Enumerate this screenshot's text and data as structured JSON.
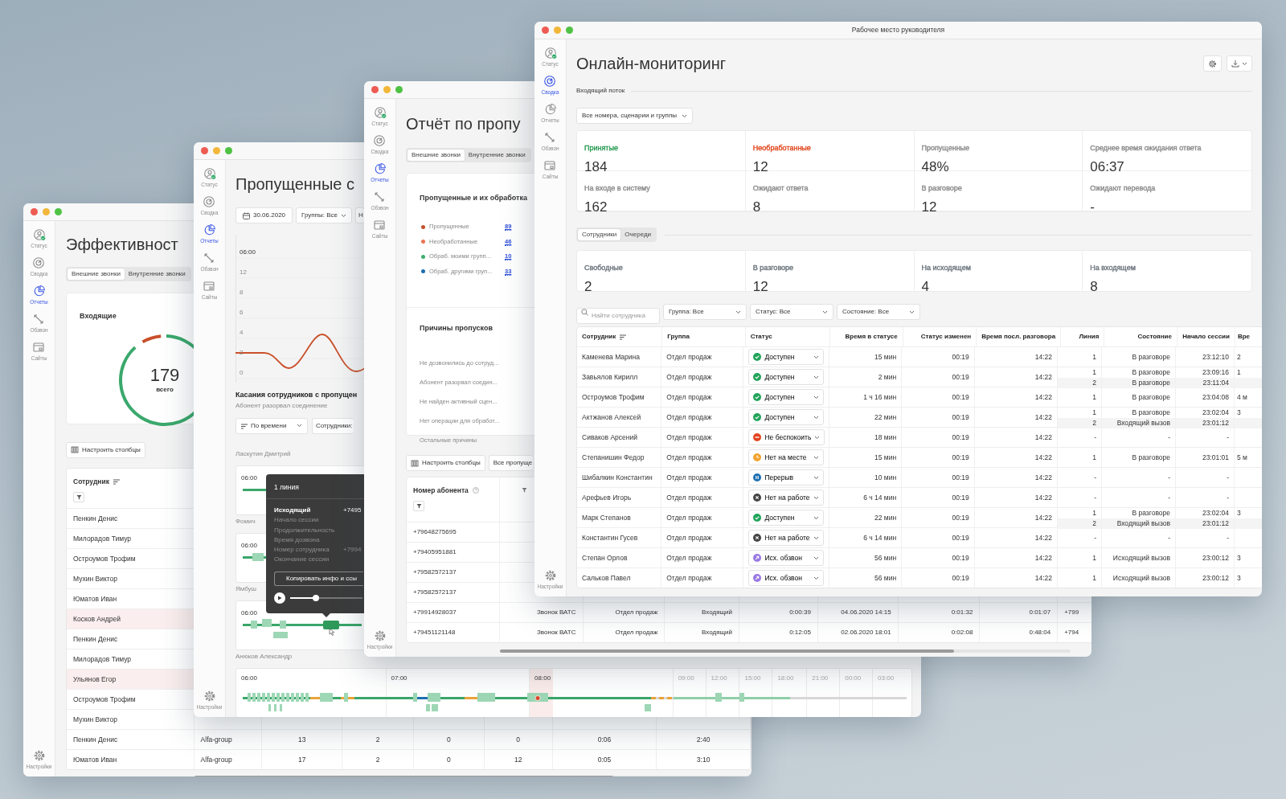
{
  "efficiency_window": {
    "sidebar": [
      {
        "label": "Статус",
        "selected": false
      },
      {
        "label": "Сводка",
        "selected": false
      },
      {
        "label": "Отчеты",
        "selected": true
      },
      {
        "label": "Обзвон",
        "selected": false
      },
      {
        "label": "Сайты",
        "selected": false
      }
    ],
    "settings": "Настройки",
    "title": "Эффективност",
    "tabs": [
      {
        "label": "Внешние звонки",
        "selected": true
      },
      {
        "label": "Внутренние звонки",
        "selected": false
      }
    ],
    "incoming_card": {
      "title": "Входящие",
      "total": "179",
      "caption": "всего"
    },
    "columns_button": "Настроить столбцы",
    "table": {
      "columns": [
        "Сотрудник"
      ],
      "rows": [
        {
          "cells": [
            "Пенкин Денис"
          ],
          "highlighted": false
        },
        {
          "cells": [
            "Милорадов Тимур"
          ],
          "highlighted": false
        },
        {
          "cells": [
            "Остроумов Трофим"
          ],
          "highlighted": false
        },
        {
          "cells": [
            "Мухин Виктор"
          ],
          "highlighted": false
        },
        {
          "cells": [
            "Юматов Иван"
          ],
          "highlighted": false
        },
        {
          "cells": [
            "Косков Андрей"
          ],
          "highlighted": true
        },
        {
          "cells": [
            "Пенкин Денис"
          ],
          "highlighted": false
        },
        {
          "cells": [
            "Милорадов Тимур"
          ],
          "highlighted": false
        },
        {
          "cells": [
            "Ульянов Егор"
          ],
          "highlighted": true
        },
        {
          "cells": [
            "Остроумов Трофим"
          ],
          "highlighted": false
        },
        {
          "cells": [
            "Мухин Виктор"
          ],
          "highlighted": false
        },
        {
          "cells": [
            "Пенкин Денис",
            "Alfa-group",
            "13",
            "2",
            "0",
            "0",
            "0:06",
            "2:40"
          ],
          "highlighted": false
        },
        {
          "cells": [
            "Юматов Иван",
            "Alfa-group",
            "17",
            "2",
            "0",
            "12",
            "0:05",
            "3:10"
          ],
          "highlighted": false
        }
      ]
    }
  },
  "missed_window": {
    "sidebar": [
      {
        "label": "Статус",
        "selected": false
      },
      {
        "label": "Сводка",
        "selected": false
      },
      {
        "label": "Отчеты",
        "selected": true
      },
      {
        "label": "Обзвон",
        "selected": false
      },
      {
        "label": "Сайты",
        "selected": false
      }
    ],
    "settings": "Настройки",
    "title": "Пропущенные с",
    "filters": [
      {
        "kind": "date",
        "label": "30.06.2020"
      },
      {
        "kind": "select",
        "label": "Группы: Все"
      },
      {
        "kind": "cut",
        "label": "Н"
      }
    ],
    "chart": {
      "time_label": "06:00",
      "y_labels": [
        "12",
        "8",
        "6",
        "4",
        "2",
        "0"
      ]
    },
    "touches": {
      "title": "Касания сотрудников с пропущен",
      "subtitle": "Абонент разорвал соединение",
      "sort_button": "По времени",
      "employees_button": "Сотрудники:"
    },
    "timelines": [
      {
        "kind": "compact",
        "employee": "Ласкутин Дмитрий",
        "ticks": [
          {
            "label": "06:00",
            "dimmed": false
          }
        ]
      },
      {
        "kind": "compact",
        "employee": "Фомич",
        "ticks": [
          {
            "label": "06:00",
            "dimmed": false
          }
        ]
      },
      {
        "kind": "compact",
        "employee": "Ямбуш",
        "ticks": [
          {
            "label": "06:00",
            "dimmed": false
          }
        ]
      },
      {
        "kind": "full",
        "employee": "Анюков Александр",
        "ticks": [
          {
            "label": "06:00",
            "dimmed": false
          },
          {
            "label": "07:00",
            "dimmed": false
          },
          {
            "label": "08:00",
            "dimmed": false
          },
          {
            "label": "09:00",
            "dimmed": true
          },
          {
            "label": "12:00",
            "dimmed": true
          },
          {
            "label": "15:00",
            "dimmed": true
          },
          {
            "label": "18:00",
            "dimmed": true
          },
          {
            "label": "21:00",
            "dimmed": true
          },
          {
            "label": "00:00",
            "dimmed": true
          },
          {
            "label": "03:00",
            "dimmed": true
          }
        ]
      }
    ],
    "tooltip": {
      "title": "1 линия",
      "rows": [
        {
          "label": "Исходящий",
          "value": "+7495",
          "emphasized": true
        },
        {
          "label": "Начало сессии",
          "emphasized": false
        },
        {
          "label": "Продолжительность",
          "emphasized": false
        },
        {
          "label": "Время дозвона",
          "emphasized": false
        },
        {
          "label": "Номер сотрудника",
          "value": "+7994",
          "emphasized": false
        },
        {
          "label": "Окончание сессии",
          "emphasized": false
        }
      ],
      "copy_button": "Копировать инфо и ссы",
      "player": {
        "level": 0.35
      }
    }
  },
  "report_window": {
    "sidebar": [
      {
        "label": "Статус",
        "selected": false
      },
      {
        "label": "Сводка",
        "selected": false
      },
      {
        "label": "Отчеты",
        "selected": true
      },
      {
        "label": "Обзвон",
        "selected": false
      },
      {
        "label": "Сайты",
        "selected": false
      }
    ],
    "settings": "Настройки",
    "title": "Отчёт по пропу",
    "tabs": [
      {
        "label": "Внешние звонки",
        "selected": true
      },
      {
        "label": "Внутренние звонки",
        "selected": false
      }
    ],
    "missed_card": {
      "title": "Пропущенные и их обработка",
      "legend": [
        {
          "label": "Пропущенные",
          "count": "89",
          "color": "#c4532d"
        },
        {
          "label": "Необработанные",
          "count": "46",
          "color": "#ec7350"
        },
        {
          "label": "Обраб. моими групп...",
          "count": "10",
          "color": "#3dae70"
        },
        {
          "label": "Обраб. другими груп...",
          "count": "33",
          "color": "#1d6eb0"
        }
      ]
    },
    "reasons_card": {
      "title": "Причины пропусков",
      "items": [
        "Не дозвонились до сотруд...",
        "Абонент разорвал соедин...",
        "Не найден активный сцен...",
        "Нет операции для обработ...",
        "Остальные причины"
      ]
    },
    "columns_button": "Настроить столбцы",
    "filter_button": "Все пропуще",
    "table": {
      "columns": [
        "Номер абонента"
      ],
      "rows": [
        {
          "cells": [
            "+79648275695"
          ]
        },
        {
          "cells": [
            "+79405951881"
          ]
        },
        {
          "cells": [
            "+79582572137"
          ]
        },
        {
          "cells": [
            "+79582572137"
          ]
        },
        {
          "cells": [
            "+79914928037",
            "Звонок ВАТС",
            "Отдел продаж",
            "Входящий",
            "0:00:39",
            "04.06.2020 14:15",
            "0:01:32",
            "0:01:07",
            "+799"
          ]
        },
        {
          "cells": [
            "+79451121148",
            "Звонок ВАТС",
            "Отдел продаж",
            "Входящий",
            "0:12:05",
            "02.06.2020 18:01",
            "0:02:08",
            "0:48:04",
            "+794"
          ]
        }
      ]
    }
  },
  "monitoring_window": {
    "window_title": "Рабочее место руководителя",
    "sidebar": [
      {
        "label": "Статус",
        "selected": false
      },
      {
        "label": "Сводка",
        "selected": true
      },
      {
        "label": "Отчеты",
        "selected": false
      },
      {
        "label": "Обзвон",
        "selected": false
      },
      {
        "label": "Сайты",
        "selected": false
      }
    ],
    "settings": "Настройки",
    "title": "Онлайн-мониторинг",
    "incoming_section": "Входящий поток",
    "scope_select": "Все номера, сценарии и группы",
    "flow_stats": [
      {
        "label": "Принятые",
        "value": "184",
        "color": "#2a9d54"
      },
      {
        "label": "Необработанные",
        "value": "12",
        "color": "#e2471d"
      },
      {
        "label": "Пропущенные",
        "value": "48%",
        "color": "#8c8c8c"
      },
      {
        "label": "Среднее время ожидания ответа",
        "value": "06:37",
        "color": "#8c8c8c"
      },
      {
        "label": "На входе в систему",
        "value": "162",
        "color": "#8c8c8c"
      },
      {
        "label": "Ожидают ответа",
        "value": "8",
        "color": "#8c8c8c"
      },
      {
        "label": "В разговоре",
        "value": "12",
        "color": "#8c8c8c"
      },
      {
        "label": "Ожидают перевода",
        "value": "-",
        "color": "#8c8c8c"
      }
    ],
    "tabs": [
      {
        "label": "Сотрудники",
        "selected": true
      },
      {
        "label": "Очереди",
        "selected": false
      }
    ],
    "staff_stats": [
      {
        "label": "Свободные",
        "value": "2"
      },
      {
        "label": "В разговоре",
        "value": "12"
      },
      {
        "label": "На исходящем",
        "value": "4"
      },
      {
        "label": "На входящем",
        "value": "8"
      }
    ],
    "search": {
      "placeholder": "Найти сотрудника"
    },
    "filters": [
      "Группа: Все",
      "Статус: Все",
      "Состояние: Все"
    ],
    "table": {
      "columns": [
        "Сотрудник",
        "Группа",
        "Статус",
        "Время в статусе",
        "Статус изменен",
        "Время посл. разговора",
        "Линия",
        "Состояние",
        "Начало сессии",
        "Вре"
      ],
      "rows": [
        {
          "employee": "Каменева Марина",
          "group": "Отдел продаж",
          "status": {
            "kind": "available",
            "label": "Доступен"
          },
          "time_in_status": "15 мин",
          "status_changed": "00:19",
          "last_call": "14:22",
          "lines": [
            {
              "line": "1",
              "state": "В разговоре",
              "session_start": "23:12:10",
              "column_10": "2"
            }
          ]
        },
        {
          "employee": "Завьялов Кирилл",
          "group": "Отдел продаж",
          "status": {
            "kind": "available",
            "label": "Доступен"
          },
          "time_in_status": "2 мин",
          "status_changed": "00:19",
          "last_call": "14:22",
          "lines": [
            {
              "line": "1",
              "state": "В разговоре",
              "session_start": "23:09:16",
              "column_10": "1"
            },
            {
              "line": "2",
              "state": "В разговоре",
              "session_start": "23:11:04"
            }
          ]
        },
        {
          "employee": "Остроумов Трофим",
          "group": "Отдел продаж",
          "status": {
            "kind": "available",
            "label": "Доступен"
          },
          "time_in_status": "1 ч 16 мин",
          "status_changed": "00:19",
          "last_call": "14:22",
          "lines": [
            {
              "line": "1",
              "state": "В разговоре",
              "session_start": "23:04:08",
              "column_10": "4 м"
            }
          ]
        },
        {
          "employee": "Актжанов Алексей",
          "group": "Отдел продаж",
          "status": {
            "kind": "available",
            "label": "Доступен"
          },
          "time_in_status": "22 мин",
          "status_changed": "00:19",
          "last_call": "14:22",
          "lines": [
            {
              "line": "1",
              "state": "В разговоре",
              "session_start": "23:02:04",
              "column_10": "3"
            },
            {
              "line": "2",
              "state": "Входящий вызов",
              "session_start": "23:01:12"
            }
          ]
        },
        {
          "employee": "Сиваков Арсений",
          "group": "Отдел продаж",
          "status": {
            "kind": "dnd",
            "label": "Не беспокоить"
          },
          "time_in_status": "18 мин",
          "status_changed": "00:19",
          "last_call": "14:22",
          "lines": [
            {
              "line": "-",
              "state": "-",
              "session_start": "-"
            }
          ]
        },
        {
          "employee": "Степанишин Федор",
          "group": "Отдел продаж",
          "status": {
            "kind": "away",
            "label": "Нет на месте"
          },
          "time_in_status": "15 мин",
          "status_changed": "00:19",
          "last_call": "14:22",
          "lines": [
            {
              "line": "1",
              "state": "В разговоре",
              "session_start": "23:01:01",
              "column_10": "5 м"
            }
          ]
        },
        {
          "employee": "Шибалкин Константин",
          "group": "Отдел продаж",
          "status": {
            "kind": "break",
            "label": "Перерыв"
          },
          "time_in_status": "10 мин",
          "status_changed": "00:19",
          "last_call": "14:22",
          "lines": [
            {
              "line": "-",
              "state": "-",
              "session_start": "-"
            }
          ]
        },
        {
          "employee": "Арефьев Игорь",
          "group": "Отдел продаж",
          "status": {
            "kind": "offline",
            "label": "Нет на работе"
          },
          "time_in_status": "6 ч 14 мин",
          "status_changed": "00:19",
          "last_call": "14:22",
          "lines": [
            {
              "line": "-",
              "state": "-",
              "session_start": "-"
            }
          ]
        },
        {
          "employee": "Марк Степанов",
          "group": "Отдел продаж",
          "status": {
            "kind": "available",
            "label": "Доступен"
          },
          "time_in_status": "22 мин",
          "status_changed": "00:19",
          "last_call": "14:22",
          "lines": [
            {
              "line": "1",
              "state": "В разговоре",
              "session_start": "23:02:04",
              "column_10": "3"
            },
            {
              "line": "2",
              "state": "Входящий вызов",
              "session_start": "23:01:12"
            }
          ]
        },
        {
          "employee": "Константин Гусев",
          "group": "Отдел продаж",
          "status": {
            "kind": "offline",
            "label": "Нет на работе"
          },
          "time_in_status": "6 ч 14 мин",
          "status_changed": "00:19",
          "last_call": "14:22",
          "lines": [
            {
              "line": "-",
              "state": "-",
              "session_start": "-"
            }
          ]
        },
        {
          "employee": "Степан Орлов",
          "group": "Отдел продаж",
          "status": {
            "kind": "outbound",
            "label": "Исх. обзвон"
          },
          "time_in_status": "56 мин",
          "status_changed": "00:19",
          "last_call": "14:22",
          "lines": [
            {
              "line": "1",
              "state": "Исходящий вызов",
              "session_start": "23:00:12",
              "column_10": "3"
            }
          ]
        },
        {
          "employee": "Сальков Павел",
          "group": "Отдел продаж",
          "status": {
            "kind": "outbound",
            "label": "Исх. обзвон"
          },
          "time_in_status": "56 мин",
          "status_changed": "00:19",
          "last_call": "14:22",
          "lines": [
            {
              "line": "1",
              "state": "Исходящий вызов",
              "session_start": "23:00:12",
              "column_10": "3"
            }
          ]
        }
      ]
    }
  }
}
